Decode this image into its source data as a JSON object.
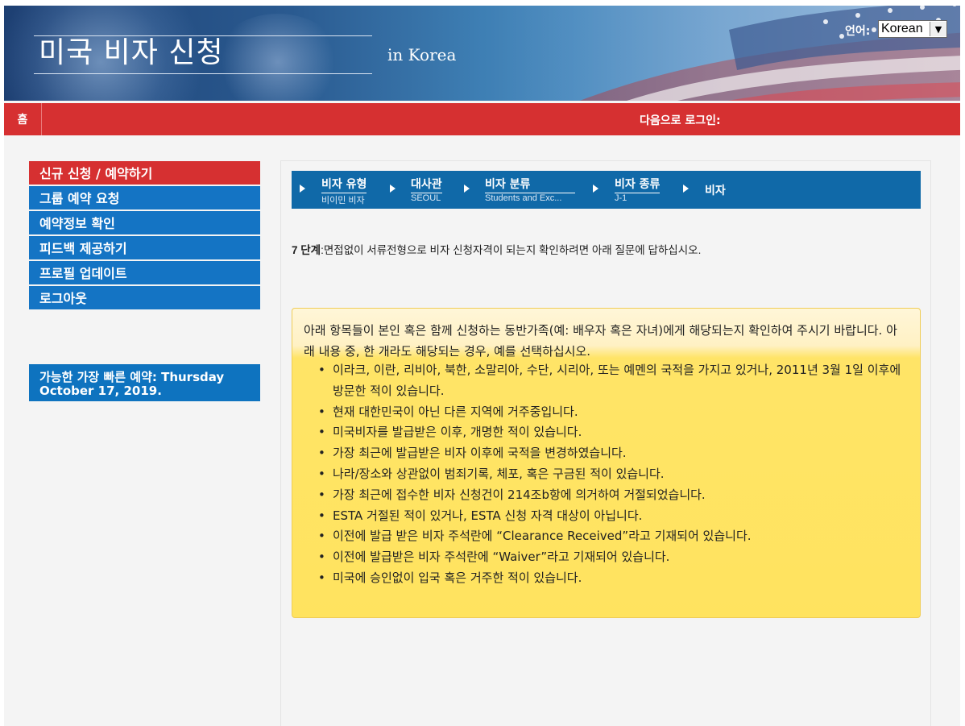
{
  "header": {
    "title": "미국 비자 신청",
    "subtitle": "in Korea",
    "language_label": "언어:",
    "language_selected": "Korean"
  },
  "navbar": {
    "home": "홈",
    "login": "다음으로 로그인:"
  },
  "sidebar": {
    "items": [
      {
        "label": "신규 신청 / 예약하기"
      },
      {
        "label": "그룹 예약 요청"
      },
      {
        "label": "예약정보 확인"
      },
      {
        "label": "피드백 제공하기"
      },
      {
        "label": "프로필 업데이트"
      },
      {
        "label": "로그아웃"
      }
    ],
    "earliest": "가능한 가장 빠른 예약: Thursday October 17, 2019."
  },
  "steps": [
    {
      "label": "비자 유형",
      "value": "비이민 비자"
    },
    {
      "label": "대사관",
      "value": "SEOUL"
    },
    {
      "label": "비자 분류",
      "value": "Students and Exc..."
    },
    {
      "label": "비자 종류",
      "value": "J-1"
    },
    {
      "label": "비자",
      "value": ""
    }
  ],
  "instruction": {
    "step": "7 단계",
    "text": ":면접없이 서류전형으로 비자 신청자격이 되는지 확인하려면 아래 질문에 답하십시오."
  },
  "notice": {
    "intro": "아래 항목들이 본인 혹은 함께 신청하는 동반가족(예: 배우자 혹은 자녀)에게 해당되는지 확인하여 주시기 바랍니다.  아래 내용 중, 한 개라도 해당되는 경우, 예를 선택하십시오.",
    "items": [
      "이라크, 이란, 리비아, 북한, 소말리아, 수단, 시리아, 또는 예멘의 국적을 가지고 있거나, 2011년 3월 1일 이후에 방문한 적이 있습니다.",
      "현재 대한민국이 아닌 다른 지역에 거주중입니다.",
      "미국비자를 발급받은 이후, 개명한 적이 있습니다.",
      "가장 최근에 발급받은 비자 이후에 국적을 변경하였습니다.",
      "나라/장소와 상관없이 범죄기록, 체포, 혹은 구금된 적이 있습니다.",
      "가장 최근에 접수한 비자 신청건이 214조b항에 의거하여 거절되었습니다.",
      "ESTA 거절된 적이 있거나, ESTA 신청 자격 대상이 아닙니다.",
      "이전에 발급 받은 비자 주석란에 “Clearance Received”라고 기재되어 있습니다.",
      "이전에 발급받은 비자 주석란에 “Waiver”라고 기재되어 있습니다.",
      "미국에 승인없이 입국 혹은 거주한 적이 있습니다."
    ]
  },
  "colors": {
    "brand_red": "#d63031",
    "menu_blue": "#1474c4",
    "steps_blue": "#1069a8",
    "notice_yellow": "#ffe35f"
  }
}
